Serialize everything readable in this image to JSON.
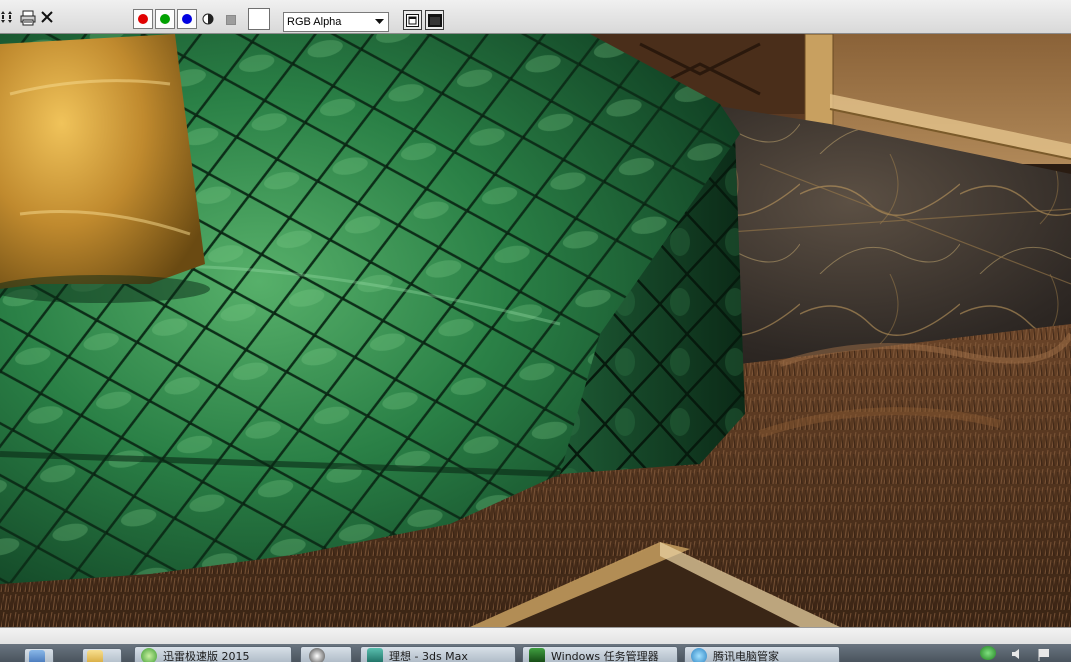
{
  "toolbar": {
    "channel_select": {
      "value": "RGB Alpha"
    },
    "channels": [
      {
        "name": "red-channel",
        "color": "#e00000"
      },
      {
        "name": "green-channel",
        "color": "#00a000"
      },
      {
        "name": "blue-channel",
        "color": "#0000e0"
      }
    ],
    "swatch_color": "#ffffff"
  },
  "colors": {
    "sofa": "#1f6b3d",
    "pillow": "#c08a2e",
    "floor_marble": "#3a3430",
    "rug": "#5a3a22",
    "gold_trim": "#c8a060"
  },
  "taskbar": {
    "items": [
      {
        "label": "",
        "icon": "windows-start-icon"
      },
      {
        "label": "",
        "icon": "folder-icon"
      },
      {
        "label": "迅雷极速版 2015",
        "icon": "thunder-app-icon"
      },
      {
        "label": "",
        "icon": "media-player-icon"
      },
      {
        "label": "理想 - 3ds Max",
        "icon": "3dsmax-app-icon"
      },
      {
        "label": "Windows 任务管理器",
        "icon": "task-manager-icon"
      },
      {
        "label": "腾讯电脑管家",
        "icon": "tencent-app-icon"
      }
    ],
    "tray": [
      "network-tray-icon",
      "speaker-tray-icon",
      "flag-tray-icon"
    ]
  }
}
